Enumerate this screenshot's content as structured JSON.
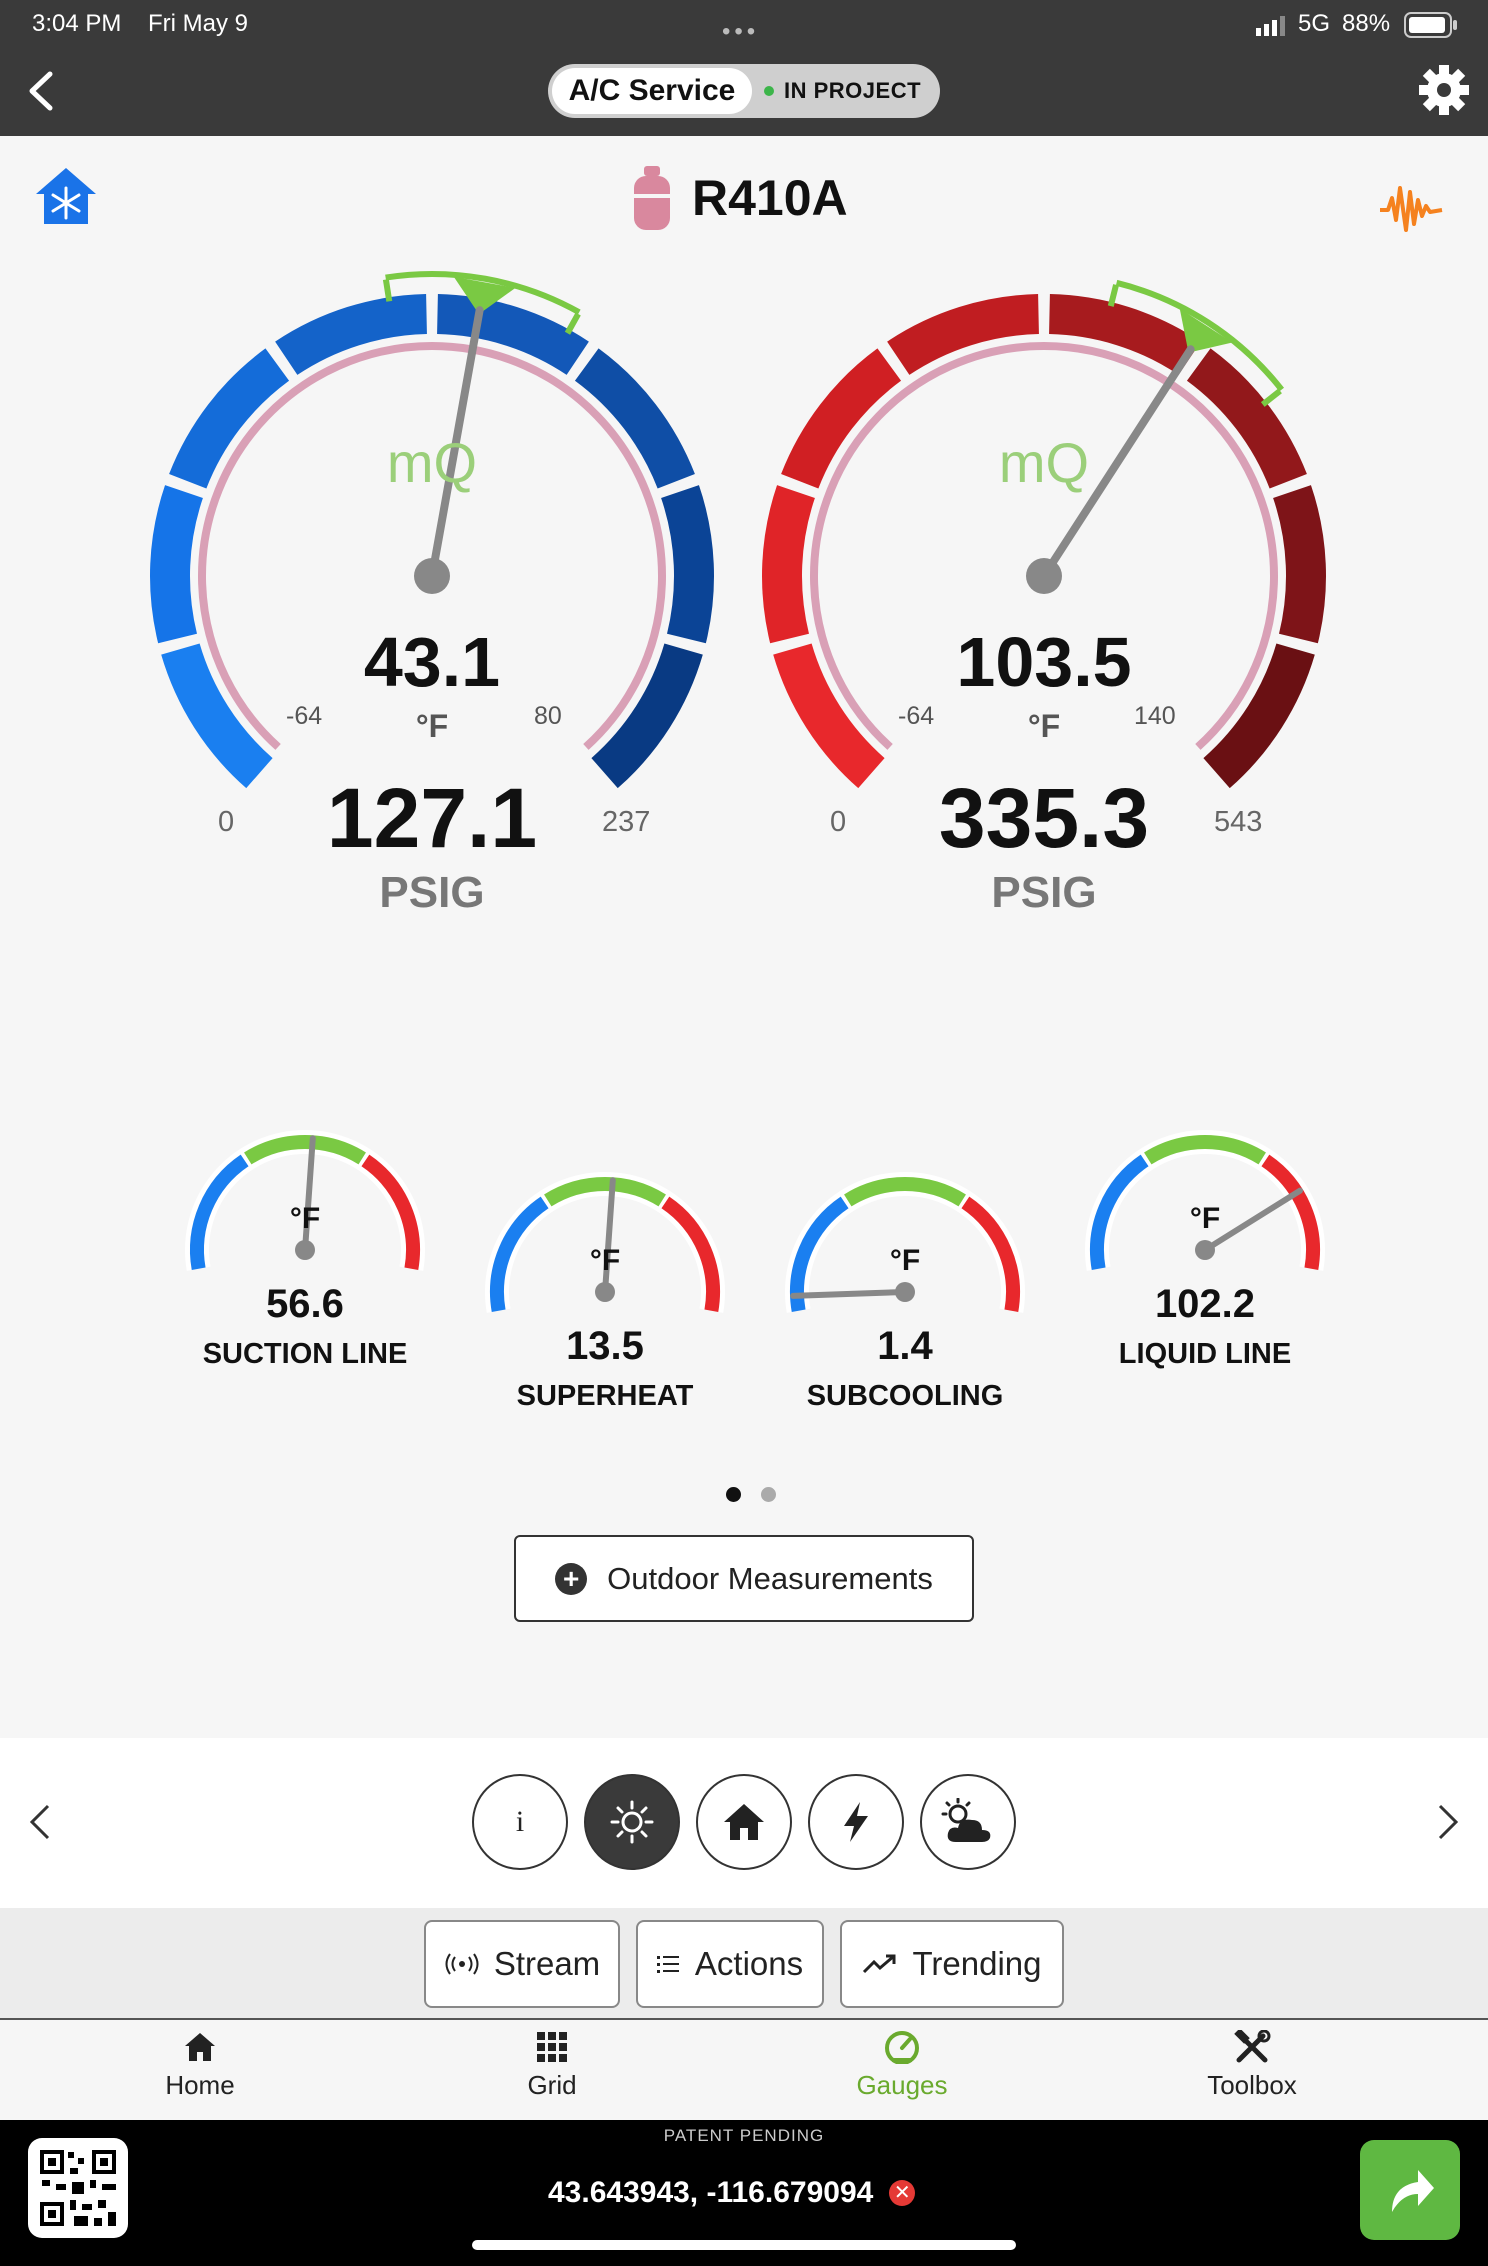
{
  "status_bar": {
    "time": "3:04 PM",
    "date": "Fri May 9",
    "network": "5G",
    "battery": "88%"
  },
  "header": {
    "back_icon": "chevron-left-icon",
    "service_label": "A/C Service",
    "project_label": "IN PROJECT",
    "settings_icon": "gear-icon"
  },
  "main": {
    "mode_icon": "house-snowflake-icon",
    "refrigerant": "R410A",
    "refrigerant_icon": "refrigerant-cylinder-icon",
    "waveform_icon": "waveform-icon",
    "colors": {
      "low_side": "#1565d8",
      "high_side": "#c62828",
      "target": "#7ac943",
      "accent_orange": "#f5821f"
    }
  },
  "gauges": {
    "low": {
      "logo": "mQ",
      "temperature": "43.1",
      "temp_unit": "°F",
      "temp_min": "-64",
      "temp_max": "80",
      "pressure": "127.1",
      "pressure_unit": "PSIG",
      "pressure_min": "0",
      "pressure_max": "237",
      "pressure_value": 127.1,
      "pressure_range": [
        0,
        237
      ]
    },
    "high": {
      "logo": "mQ",
      "temperature": "103.5",
      "temp_unit": "°F",
      "temp_min": "-64",
      "temp_max": "140",
      "pressure": "335.3",
      "pressure_unit": "PSIG",
      "pressure_min": "0",
      "pressure_max": "543",
      "pressure_value": 335.3,
      "pressure_range": [
        0,
        543
      ]
    }
  },
  "mini_gauges": [
    {
      "label": "SUCTION LINE",
      "value": "56.6",
      "unit": "°F",
      "needle_fraction": 0.52
    },
    {
      "label": "SUPERHEAT",
      "value": "13.5",
      "unit": "°F",
      "needle_fraction": 0.52
    },
    {
      "label": "SUBCOOLING",
      "value": "1.4",
      "unit": "°F",
      "needle_fraction": 0.04
    },
    {
      "label": "LIQUID LINE",
      "value": "102.2",
      "unit": "°F",
      "needle_fraction": 0.79
    }
  ],
  "pager": {
    "pages": 2,
    "current": 1
  },
  "outdoor_button": {
    "label": "Outdoor Measurements",
    "icon": "plus-circle-icon"
  },
  "section_icons": [
    "info-icon",
    "sun-icon",
    "house-icon",
    "lightning-icon",
    "cloud-sun-icon"
  ],
  "section_active": 1,
  "actions": {
    "stream": "Stream",
    "actions": "Actions",
    "trending": "Trending"
  },
  "tabs": [
    {
      "label": "Home",
      "icon": "home-icon"
    },
    {
      "label": "Grid",
      "icon": "grid-icon"
    },
    {
      "label": "Gauges",
      "icon": "gauge-icon",
      "active": true
    },
    {
      "label": "Toolbox",
      "icon": "toolbox-icon"
    }
  ],
  "footer": {
    "patent": "PATENT PENDING",
    "coordinates": "43.643943, -116.679094",
    "clear_icon": "close-icon",
    "qr_icon": "qr-code-icon",
    "share_icon": "share-arrow-icon"
  }
}
